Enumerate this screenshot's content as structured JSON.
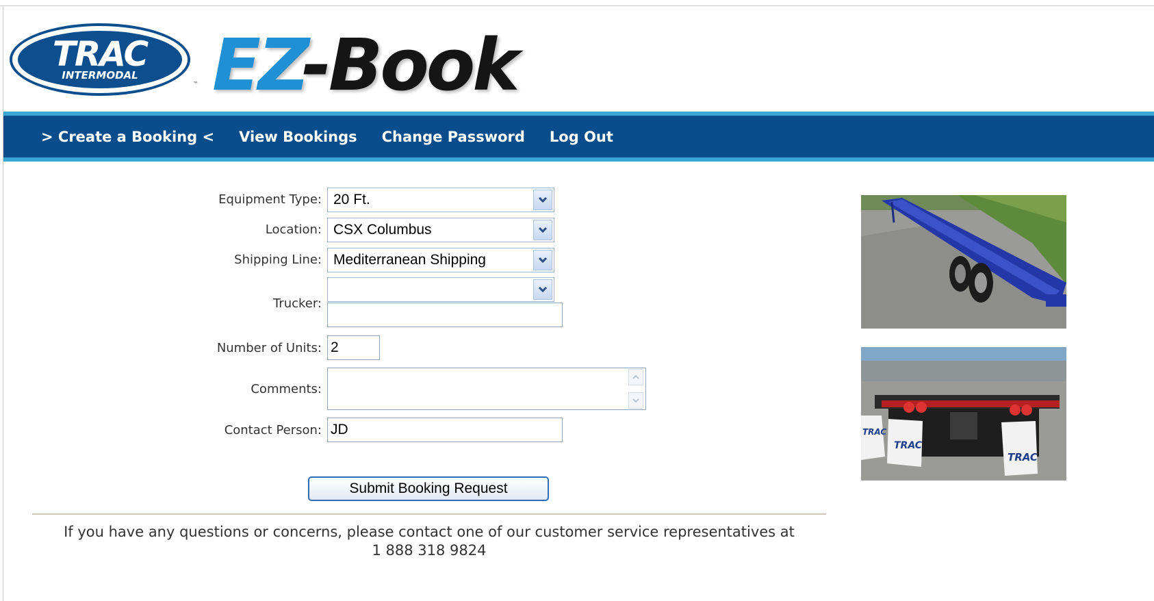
{
  "header": {
    "logo_word": "TRAC",
    "logo_sub": "INTERMODAL",
    "logo_tm": "™",
    "app_title_ez": "EZ",
    "app_title_book": "-Book"
  },
  "nav": {
    "items": [
      {
        "label": "> Create a Booking <"
      },
      {
        "label": "View Bookings"
      },
      {
        "label": "Change Password"
      },
      {
        "label": "Log Out"
      }
    ]
  },
  "form": {
    "equipment_type": {
      "label": "Equipment Type:",
      "value": "20 Ft."
    },
    "location": {
      "label": "Location:",
      "value": "CSX Columbus"
    },
    "shipping_line": {
      "label": "Shipping Line:",
      "value": "Mediterranean Shipping"
    },
    "trucker": {
      "label": "Trucker:",
      "select_value": "",
      "text_value": ""
    },
    "number_of_units": {
      "label": "Number of Units:",
      "value": "2"
    },
    "comments": {
      "label": "Comments:",
      "value": ""
    },
    "contact_person": {
      "label": "Contact Person:",
      "value": "JD"
    },
    "submit_label": "Submit Booking Request"
  },
  "footer": {
    "line1": "If you have any questions or concerns, please contact one of our customer service representatives at",
    "line2": "1 888 318 9824"
  },
  "photos": {
    "photo1_marks": "",
    "photo2_marks": [
      "TRAC",
      "TRAC",
      "TRAC"
    ]
  },
  "icons": {
    "dropdown": "chevron-down-icon",
    "scroll_up": "chevron-up-icon",
    "scroll_down": "chevron-down-icon"
  },
  "colors": {
    "nav_bg": "#0a4d8c",
    "nav_stripe": "#3aa6d6",
    "logo_blue": "#0d4e8e",
    "ez_blue": "#1f8fd6"
  }
}
